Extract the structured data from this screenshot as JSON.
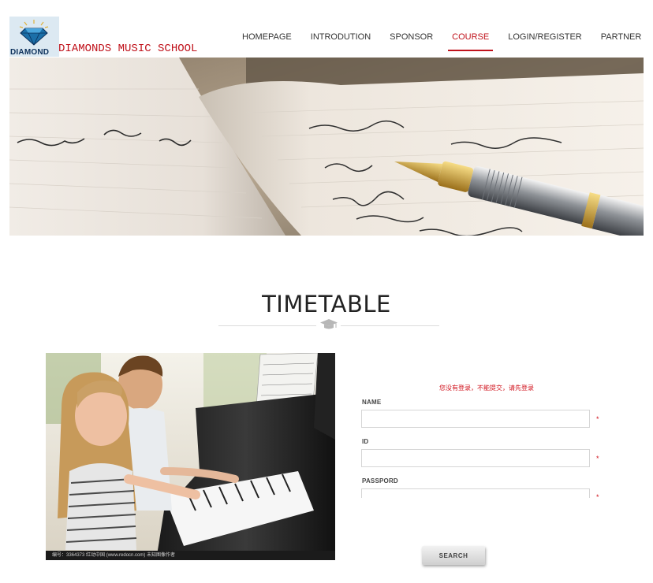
{
  "brand": {
    "logo_icon": "diamond-icon",
    "logo_text": "DIAMOND",
    "school_name": "DIAMONDS MUSIC SCHOOL"
  },
  "nav": {
    "items": [
      {
        "label": "HOMEPAGE",
        "active": false
      },
      {
        "label": "INTRODUTION",
        "active": false
      },
      {
        "label": "SPONSOR",
        "active": false
      },
      {
        "label": "COURSE",
        "active": true
      },
      {
        "label": "LOGIN/REGISTER",
        "active": false
      },
      {
        "label": "PARTNER",
        "active": false
      }
    ],
    "active_color": "#c0121b"
  },
  "section": {
    "title": "TIMETABLE",
    "divider_icon": "graduation-cap-icon"
  },
  "photo": {
    "caption": "编号：3364373   红动中国 (www.redocn.com)   未知图像作者"
  },
  "form": {
    "warning": "您没有登录，不能提交，请先登录",
    "fields": [
      {
        "label": "NAME",
        "value": "",
        "required_mark": "*"
      },
      {
        "label": "ID",
        "value": "",
        "required_mark": "*"
      },
      {
        "label": "PASSPORD",
        "value": "",
        "required_mark": "*"
      }
    ],
    "submit_label": "SEARCH"
  },
  "colors": {
    "accent_red": "#c0121b",
    "text_dark": "#222222"
  }
}
